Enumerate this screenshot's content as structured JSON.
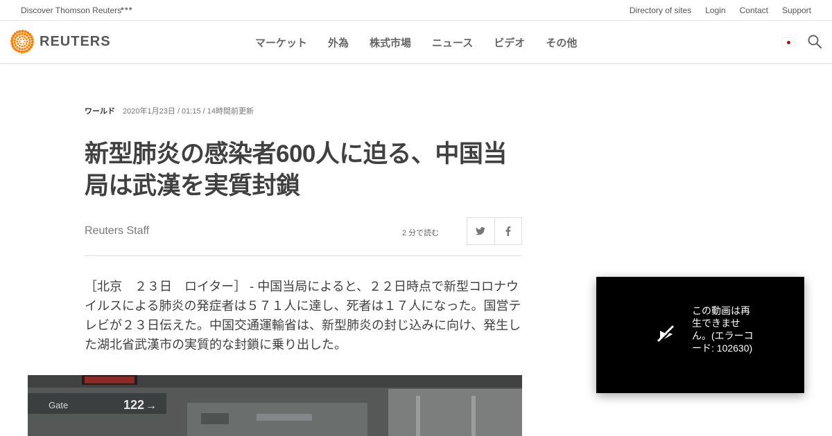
{
  "utility": {
    "discover": "Discover Thomson Reuters",
    "more": "•••",
    "links": [
      "Directory of sites",
      "Login",
      "Contact",
      "Support"
    ]
  },
  "header": {
    "logo_text": "REUTERS",
    "nav": [
      "マーケット",
      "外為",
      "株式市場",
      "ニュース",
      "ビデオ",
      "その他"
    ],
    "icons": {
      "language": "japan-flag-icon",
      "search": "search-icon"
    },
    "accent": "#ff8000"
  },
  "article": {
    "section": "ワールド",
    "date": "2020年1月23日 / 01:15 / 14時間前更新",
    "headline": "新型肺炎の感染者600人に迫る、中国当局は武漢を実質封鎖",
    "author": "Reuters Staff",
    "read_time": "2  分で読む",
    "share": [
      "twitter-icon",
      "facebook-icon"
    ],
    "body": "［北京　２３日　ロイター］ - 中国当局によると、２２日時点で新型コロナウイルスによる肺炎の発症者は５７１人に達し、死者は１７人になった。国営テレビが２３日伝えた。中国交通運輸省は、新型肺炎の封じ込みに向け、発生した湖北省武漢市の実質的な封鎖に乗り出した。",
    "photo": {
      "sign_gate": "Gate",
      "sign_number": "122",
      "sign_arrow": "→"
    }
  },
  "video": {
    "error_message": "この動画は再生できません。(エラーコード: 102630)"
  }
}
